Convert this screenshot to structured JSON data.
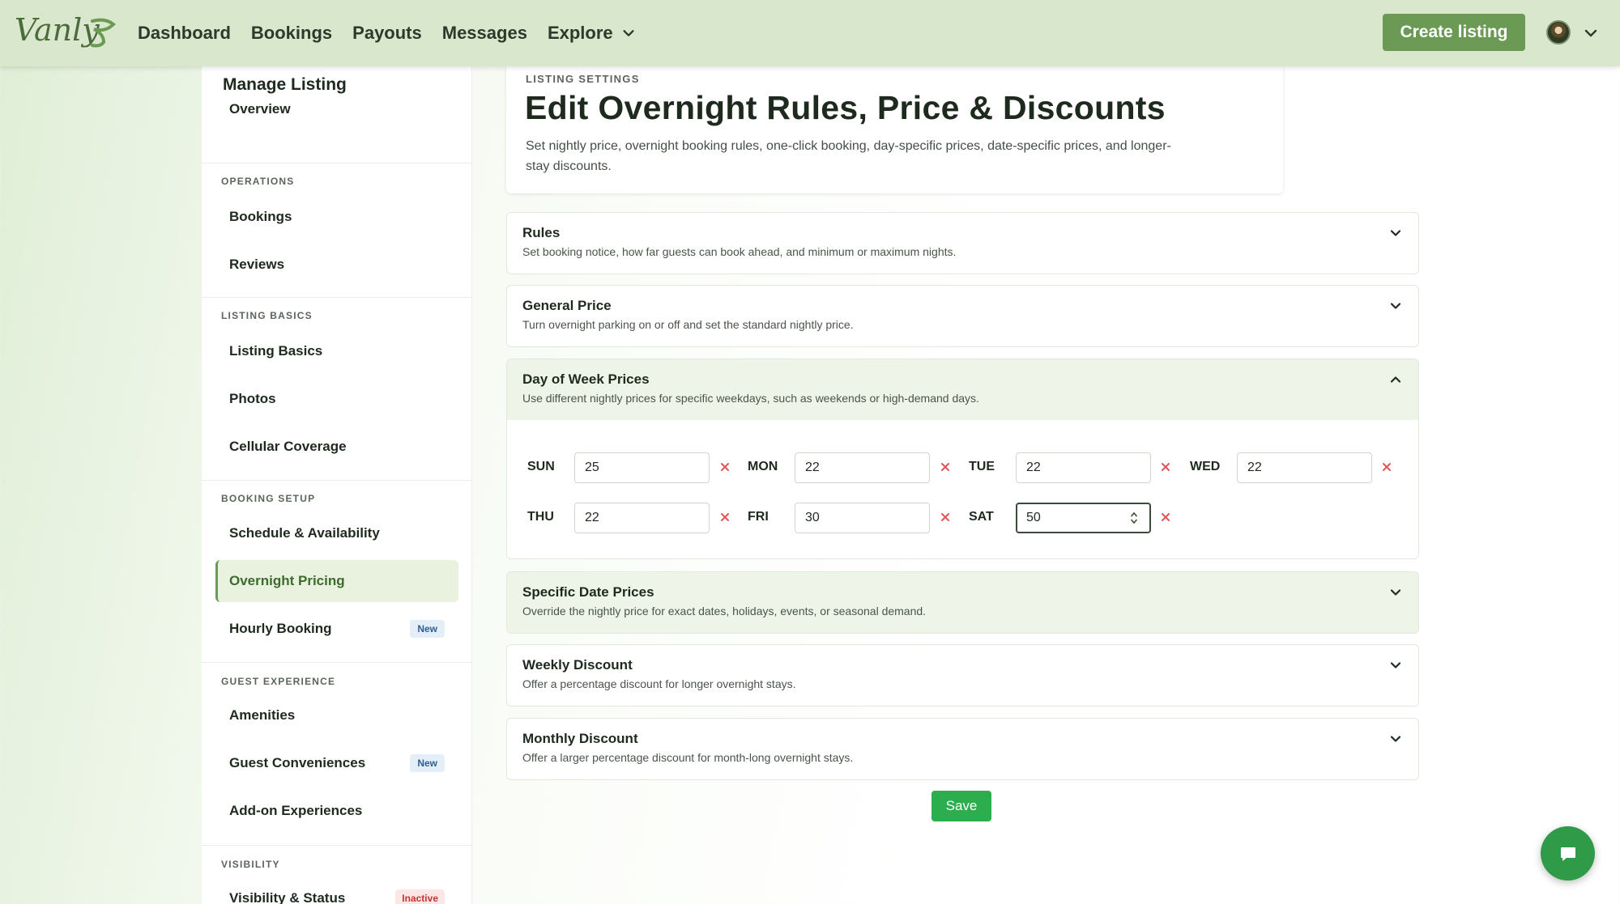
{
  "topnav": {
    "logo_text": "Vanly",
    "links": [
      "Dashboard",
      "Bookings",
      "Payouts",
      "Messages",
      "Explore"
    ],
    "create_label": "Create listing",
    "icons": {
      "explore_chevron": "chevron-down-icon",
      "account_chevron": "chevron-down-icon"
    }
  },
  "sidebar": {
    "title": "Manage Listing",
    "overview": "Overview",
    "sections": {
      "operations": "OPERATIONS",
      "listing_basics": "LISTING BASICS",
      "booking_setup": "BOOKING SETUP",
      "guest_experience": "GUEST EXPERIENCE",
      "visibility": "VISIBILITY"
    },
    "items": {
      "bookings": "Bookings",
      "reviews": "Reviews",
      "listing_basics": "Listing Basics",
      "photos": "Photos",
      "cellular": "Cellular Coverage",
      "schedule": "Schedule & Availability",
      "overnight": "Overnight Pricing",
      "hourly": "Hourly Booking",
      "amenities": "Amenities",
      "conveniences": "Guest Conveniences",
      "addons": "Add-on Experiences",
      "visibility_status": "Visibility & Status"
    },
    "badges": {
      "new": "New",
      "inactive": "Inactive"
    },
    "active_item": "Overnight Pricing"
  },
  "header": {
    "eyebrow": "LISTING SETTINGS",
    "title": "Edit Overnight Rules, Price & Discounts",
    "description": "Set nightly price, overnight booking rules, one-click booking, day-specific prices, date-specific prices, and longer-stay discounts."
  },
  "sections": {
    "rules": {
      "title": "Rules",
      "subtitle": "Set booking notice, how far guests can book ahead, and minimum or maximum nights."
    },
    "general": {
      "title": "General Price",
      "subtitle": "Turn overnight parking on or off and set the standard nightly price."
    },
    "dow": {
      "title": "Day of Week Prices",
      "subtitle": "Use different nightly prices for specific weekdays, such as weekends or high-demand days.",
      "expanded": true,
      "days": [
        {
          "label": "SUN",
          "value": "25"
        },
        {
          "label": "MON",
          "value": "22"
        },
        {
          "label": "TUE",
          "value": "22"
        },
        {
          "label": "WED",
          "value": "22"
        },
        {
          "label": "THU",
          "value": "22"
        },
        {
          "label": "FRI",
          "value": "30"
        },
        {
          "label": "SAT",
          "value": "50"
        }
      ]
    },
    "specific": {
      "title": "Specific Date Prices",
      "subtitle": "Override the nightly price for exact dates, holidays, events, or seasonal demand."
    },
    "weekly": {
      "title": "Weekly Discount",
      "subtitle": "Offer a percentage discount for longer overnight stays."
    },
    "monthly": {
      "title": "Monthly Discount",
      "subtitle": "Offer a larger percentage discount for month-long overnight stays."
    }
  },
  "save_label": "Save",
  "colors": {
    "brand": "#6b9a55",
    "save": "#2cae4f",
    "chat": "#2f9a48",
    "clear": "#e05555",
    "nav_bg": "#d9e8cc"
  }
}
